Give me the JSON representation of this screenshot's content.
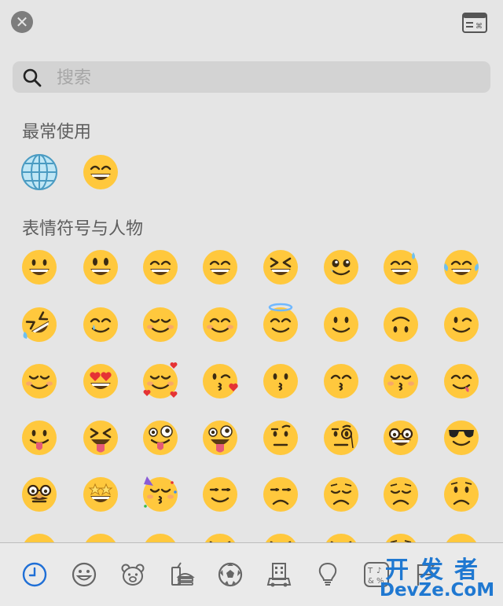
{
  "search": {
    "placeholder": "搜索"
  },
  "sections": {
    "frequently_used": {
      "title": "最常使用",
      "items": [
        "🌐",
        "😁"
      ]
    },
    "smileys_people": {
      "title": "表情符号与人物",
      "rows": [
        [
          "😀",
          "😃",
          "😄",
          "😁",
          "😆",
          "🥹",
          "😅",
          "😂"
        ],
        [
          "🤣",
          "🥲",
          "☺️",
          "😊",
          "😇",
          "🙂",
          "🙃",
          "😉"
        ],
        [
          "😌",
          "😍",
          "🥰",
          "😘",
          "😗",
          "😙",
          "😚",
          "😋"
        ],
        [
          "😛",
          "😝",
          "😜",
          "🤪",
          "🤨",
          "🧐",
          "🤓",
          "😎"
        ],
        [
          "🥸",
          "🤩",
          "🥳",
          "😏",
          "😒",
          "😞",
          "😔",
          "😟"
        ],
        [
          "😕",
          "🙁",
          "☹️",
          "😣",
          "😖",
          "😫",
          "😩",
          "🥺"
        ]
      ]
    }
  },
  "categories": [
    {
      "name": "recent",
      "icon": "clock-icon",
      "active": true
    },
    {
      "name": "smileys",
      "icon": "smiley-icon",
      "active": false
    },
    {
      "name": "animals",
      "icon": "bear-icon",
      "active": false
    },
    {
      "name": "food",
      "icon": "food-icon",
      "active": false
    },
    {
      "name": "activity",
      "icon": "soccer-icon",
      "active": false
    },
    {
      "name": "travel",
      "icon": "building-icon",
      "active": false
    },
    {
      "name": "objects",
      "icon": "lightbulb-icon",
      "active": false
    },
    {
      "name": "symbols",
      "icon": "symbols-icon",
      "active": false
    },
    {
      "name": "flags",
      "icon": "flag-icon",
      "active": false
    }
  ],
  "watermark": {
    "top": "开发者",
    "bottom": "DevZe.CoM"
  },
  "colors": {
    "active_category": "#1f6fd6",
    "emoji_face": "#ffc83d",
    "watermark": "#1f78d1"
  }
}
